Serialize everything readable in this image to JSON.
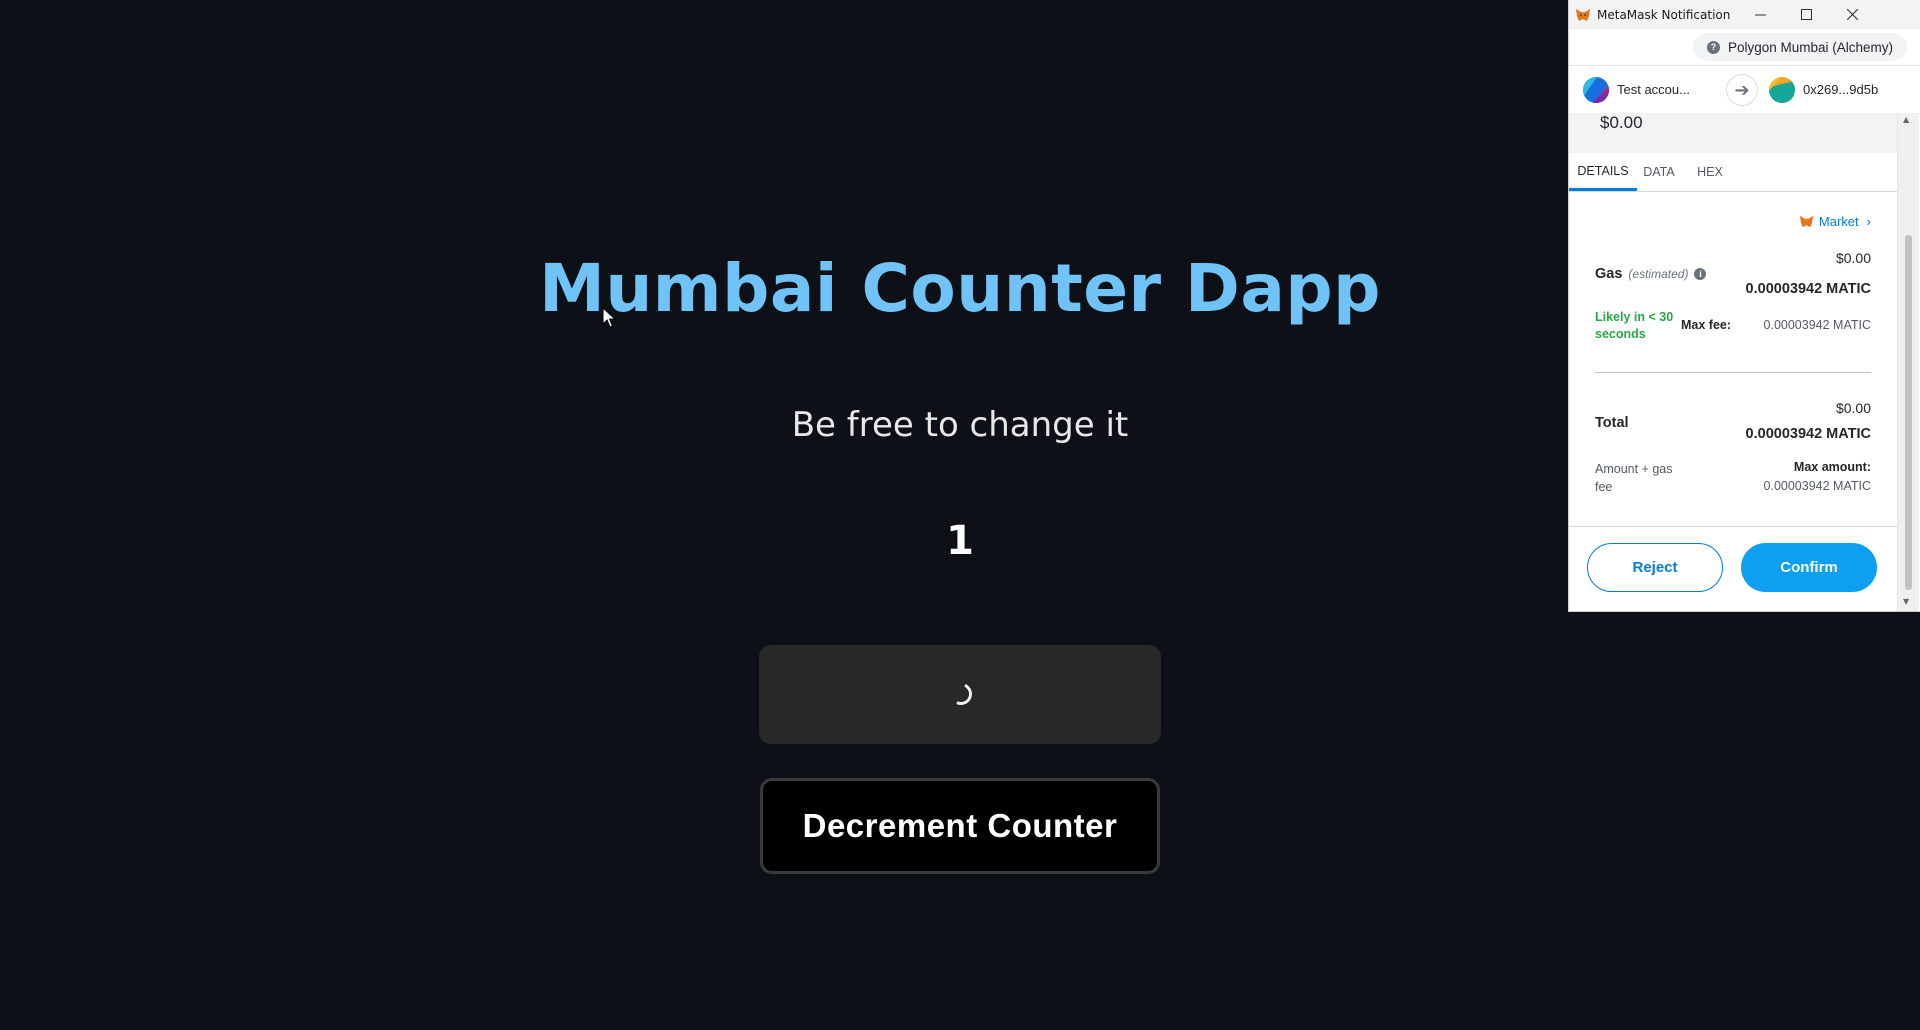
{
  "dapp": {
    "title": "Mumbai Counter Dapp",
    "subtitle": "Be free to change it",
    "counter": "1",
    "decrement_label": "Decrement Counter"
  },
  "metamask": {
    "window_title": "MetaMask Notification",
    "network": "Polygon Mumbai (Alchemy)",
    "from_account": "Test accou...",
    "to_account": "0x269...9d5b",
    "amount_fiat": "$0.00",
    "tabs": [
      "DETAILS",
      "DATA",
      "HEX"
    ],
    "market_label": "Market",
    "gas": {
      "label": "Gas",
      "estimated": "(estimated)",
      "fiat": "$0.00",
      "amount": "0.00003942 MATIC",
      "likely": "Likely in < 30 seconds",
      "max_fee_label": "Max fee:",
      "max_fee_value": "0.00003942 MATIC"
    },
    "total": {
      "label": "Total",
      "fiat": "$0.00",
      "amount": "0.00003942 MATIC",
      "sub_label": "Amount + gas fee",
      "max_amount_label": "Max amount:",
      "max_amount_value": "0.00003942 MATIC"
    },
    "reject_label": "Reject",
    "confirm_label": "Confirm"
  },
  "colors": {
    "background": "#0d1117",
    "title": "#6fc3f7",
    "mm_primary": "#037dd6",
    "mm_likely": "#28a745"
  }
}
